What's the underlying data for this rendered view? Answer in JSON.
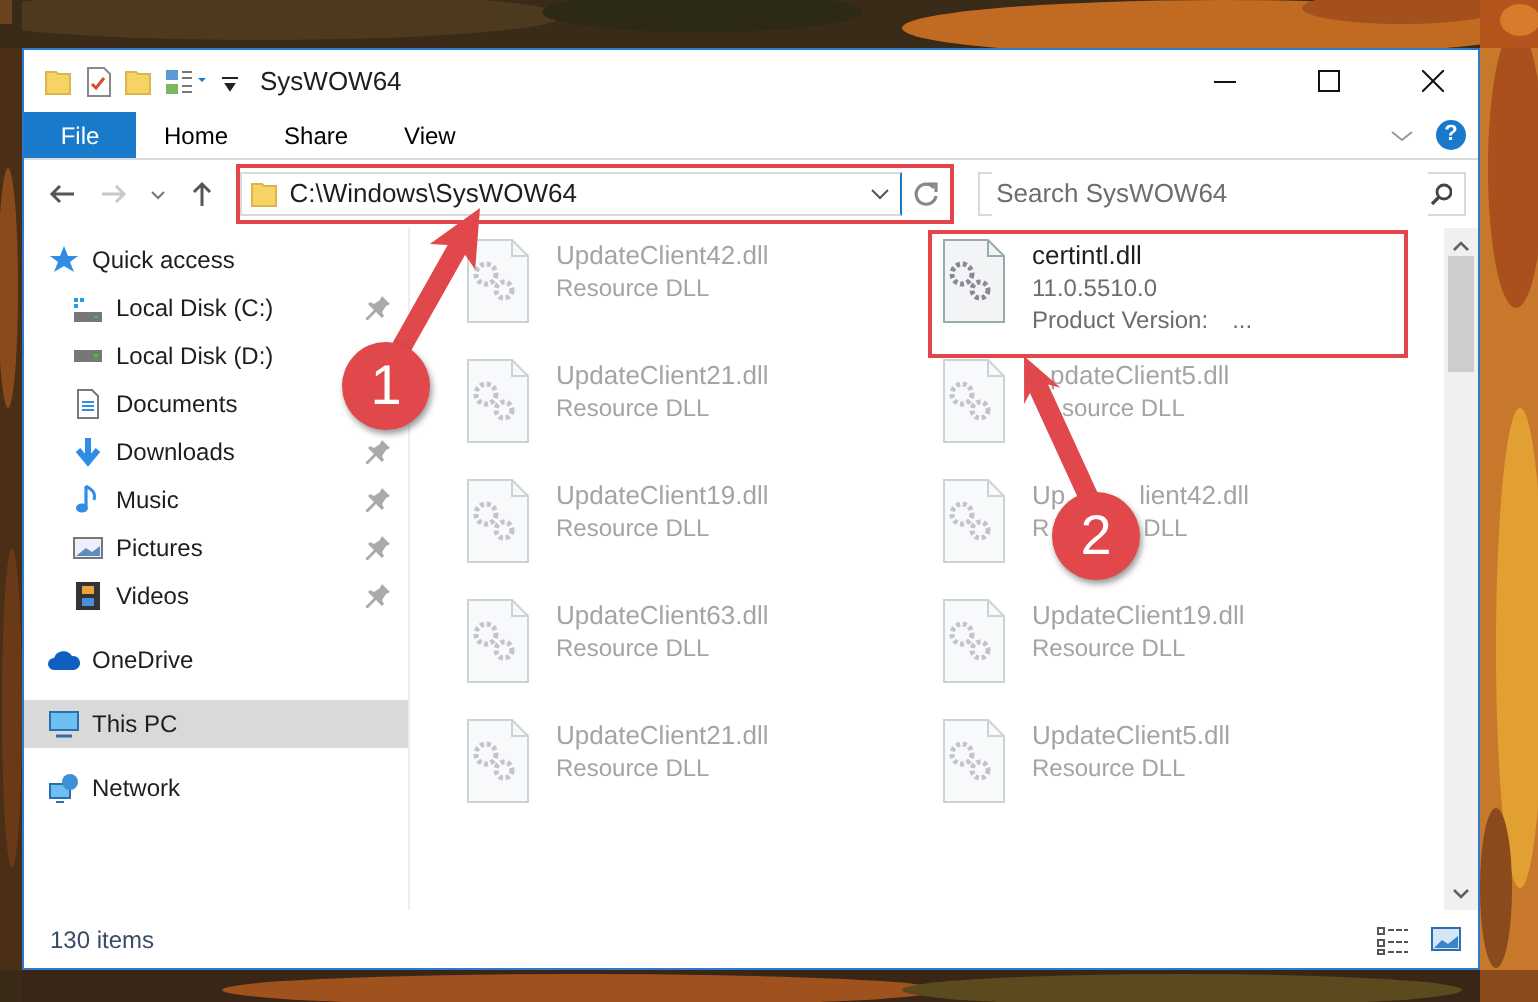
{
  "window": {
    "title": "SysWOW64"
  },
  "ribbon": {
    "tabs": [
      {
        "label": "File",
        "kind": "file"
      },
      {
        "label": "Home",
        "kind": "tab"
      },
      {
        "label": "Share",
        "kind": "tab"
      },
      {
        "label": "View",
        "kind": "tab"
      }
    ],
    "help": "?"
  },
  "address_bar": {
    "path": "C:\\Windows\\SysWOW64",
    "highlighted": true
  },
  "search": {
    "placeholder": "Search SysWOW64"
  },
  "sidebar": {
    "items": [
      {
        "label": "Quick access",
        "kind": "star",
        "pinned": false,
        "selected": false
      },
      {
        "label": "Local Disk (C:)",
        "kind": "system-drive",
        "pinned": true,
        "selected": false
      },
      {
        "label": "Local Disk (D:)",
        "kind": "drive",
        "pinned": false,
        "selected": false
      },
      {
        "label": "Documents",
        "kind": "document",
        "pinned": false,
        "selected": false
      },
      {
        "label": "Downloads",
        "kind": "download",
        "pinned": true,
        "selected": false
      },
      {
        "label": "Music",
        "kind": "music",
        "pinned": true,
        "selected": false
      },
      {
        "label": "Pictures",
        "kind": "pictures",
        "pinned": true,
        "selected": false
      },
      {
        "label": "Videos",
        "kind": "videos",
        "pinned": true,
        "selected": false
      },
      {
        "label": "OneDrive",
        "kind": "cloud",
        "pinned": false,
        "selected": false
      },
      {
        "label": "This PC",
        "kind": "computer",
        "pinned": false,
        "selected": true
      },
      {
        "label": "Network",
        "kind": "network",
        "pinned": false,
        "selected": false
      }
    ]
  },
  "files": [
    {
      "name": [
        "UpdateClient42.dll"
      ],
      "lines": [
        [
          "Resource DLL"
        ]
      ],
      "dimmed": true,
      "highlighted": false
    },
    {
      "name": [
        "certintl.dll"
      ],
      "lines": [
        [
          "11.0.5510.0"
        ],
        [
          "Product Version:",
          "..."
        ]
      ],
      "dimmed": false,
      "highlighted": true
    },
    {
      "name": [
        "UpdateClient21.dll"
      ],
      "lines": [
        [
          "Resource DLL"
        ]
      ],
      "dimmed": true,
      "highlighted": false
    },
    {
      "name": [
        "pdateClient5.dll"
      ],
      "lines": [
        [
          "source DLL"
        ]
      ],
      "dimmed": true,
      "highlighted": false
    },
    {
      "name": [
        "UpdateClient19.dll"
      ],
      "lines": [
        [
          "Resource DLL"
        ]
      ],
      "dimmed": true,
      "highlighted": false
    },
    {
      "name": [
        "Up",
        "lient42.dll"
      ],
      "lines": [
        [
          "R",
          "DLL"
        ]
      ],
      "dimmed": true,
      "highlighted": false
    },
    {
      "name": [
        "UpdateClient63.dll"
      ],
      "lines": [
        [
          "Resource DLL"
        ]
      ],
      "dimmed": true,
      "highlighted": false
    },
    {
      "name": [
        "UpdateClient19.dll"
      ],
      "lines": [
        [
          "Resource DLL"
        ]
      ],
      "dimmed": true,
      "highlighted": false
    },
    {
      "name": [
        "UpdateClient21.dll"
      ],
      "lines": [
        [
          "Resource DLL"
        ]
      ],
      "dimmed": true,
      "highlighted": false
    },
    {
      "name": [
        "UpdateClient5.dll"
      ],
      "lines": [
        [
          "Resource DLL"
        ]
      ],
      "dimmed": true,
      "highlighted": false
    }
  ],
  "status_bar": {
    "count": "130 items"
  },
  "annotations": [
    {
      "label": "1"
    },
    {
      "label": "2"
    }
  ]
}
